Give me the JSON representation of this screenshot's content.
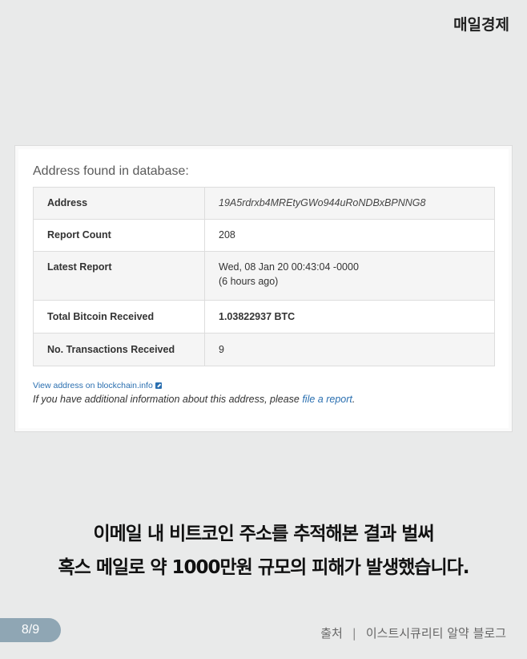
{
  "brand": "매일경제",
  "card": {
    "title": "Address found in database:",
    "rows": [
      {
        "label": "Address",
        "value": "19A5rdrxb4MREtyGWo944uRoNDBxBPNNG8"
      },
      {
        "label": "Report Count",
        "value": "208"
      },
      {
        "label": "Latest Report",
        "value": "Wed, 08 Jan 20 00:43:04 -0000",
        "subvalue": "(6 hours ago)"
      },
      {
        "label": "Total Bitcoin Received",
        "value": "1.03822937 BTC"
      },
      {
        "label": "No. Transactions Received",
        "value": "9"
      }
    ],
    "blockchain_link": "View address on blockchain.info",
    "note_prefix": "If you have additional information about this address, please ",
    "note_link": "file a report",
    "note_suffix": "."
  },
  "caption": {
    "line1": "이메일 내 비트코인 주소를 추적해본 결과 벌써",
    "line2": "혹스 메일로 약 1000만원 규모의 피해가 발생했습니다."
  },
  "footer": {
    "page": "8/9",
    "source_label": "출처",
    "separator": "|",
    "source_name": "이스트시큐리티 알약 블로그"
  },
  "colors": {
    "background": "#e9eaea",
    "link": "#2a6fb0",
    "badge": "#8fa6b4"
  },
  "icons": {
    "external_link": "external-link-icon"
  }
}
